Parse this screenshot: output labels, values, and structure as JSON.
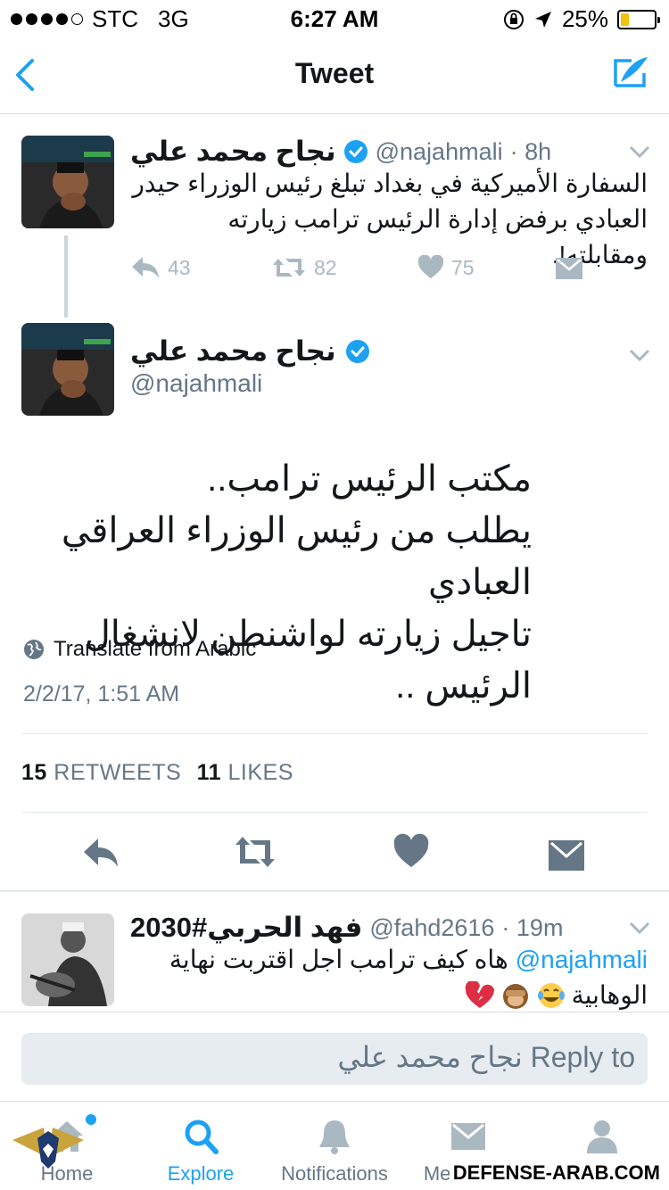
{
  "status": {
    "carrier": "STC",
    "network": "3G",
    "time": "6:27 AM",
    "battery_pct": "25%",
    "battery_level": 0.25
  },
  "nav": {
    "title": "Tweet"
  },
  "tweet_parent": {
    "name": "نجاح محمد علي",
    "handle": "@najahmali",
    "age": "· 8h",
    "text": "السفارة الأميركية في بغداد تبلغ رئيس الوزراء حيدر العبادي برفض إدارة الرئيس ترامب زيارته ومقابلته!.",
    "replies": "43",
    "retweets": "82",
    "likes": "75"
  },
  "tweet_main": {
    "name": "نجاح محمد علي",
    "handle": "@najahmali",
    "lines": [
      "مكتب الرئيس ترامب..",
      "يطلب  من رئيس الوزراء العراقي العبادي",
      "تاجيل زيارته لواشنطن لانشغال الرئيس .."
    ],
    "translate": "Translate from Arabic",
    "timestamp": "2/2/17, 1:51 AM",
    "retweets_count": "15",
    "retweets_label": "RETWEETS",
    "likes_count": "11",
    "likes_label": "LIKES"
  },
  "reply_tweet": {
    "name": "فهد الحربي#2030",
    "handle": "@fahd2616",
    "age": "· 19m",
    "mention": "@najahmali",
    "text_line1": "هاه كيف ترامب اجل اقتربت نهاية",
    "text_line2": "الوهابية"
  },
  "reply_bar": {
    "placeholder": "Reply to نجاح محمد علي"
  },
  "tabs": [
    {
      "label": "Home",
      "icon": "home-icon"
    },
    {
      "label": "Explore",
      "icon": "search-icon"
    },
    {
      "label": "Notifications",
      "icon": "bell-icon"
    },
    {
      "label": "Messages",
      "icon": "envelope-icon"
    },
    {
      "label": "Me",
      "icon": "profile-icon"
    }
  ],
  "watermark": "DEFENSE-ARAB.COM",
  "colors": {
    "accent": "#1da1f2",
    "verified": "#1da1f2",
    "muted": "#657786",
    "icon_gray": "#aab8c2"
  }
}
